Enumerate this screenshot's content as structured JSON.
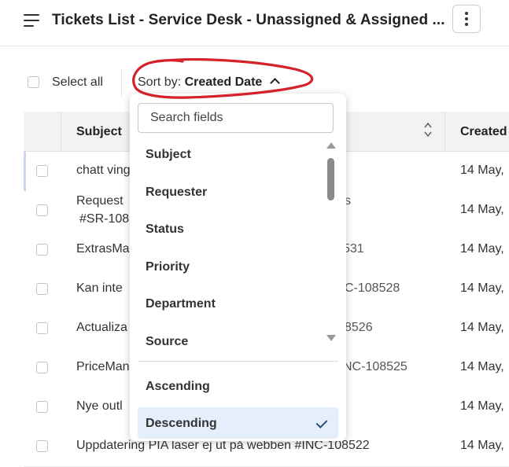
{
  "header": {
    "title": "Tickets List  -  Service Desk - Unassigned & Assigned ...",
    "menu_icon": "hamburger-icon",
    "more_icon": "kebab-menu-icon"
  },
  "toolbar": {
    "select_all_label": "Select all",
    "sort_prefix": "Sort by:",
    "sort_value": "Created Date"
  },
  "table": {
    "columns": [
      "Subject",
      "Created"
    ],
    "rows": [
      {
        "subject": "chatt ving",
        "subject_line2": "",
        "mid": "",
        "created": "14 May,"
      },
      {
        "subject": "Request",
        "subject_line2": "#SR-108",
        "mid": "s",
        "created": "14 May,"
      },
      {
        "subject": "ExtrasMa",
        "subject_line2": "",
        "mid": "531",
        "created": "14 May,"
      },
      {
        "subject": "Kan inte",
        "subject_line2": "",
        "mid": "C-108528",
        "created": "14 May,"
      },
      {
        "subject": "Actualiza",
        "subject_line2": "",
        "mid": "8526",
        "created": "14 May,"
      },
      {
        "subject": "PriceMan",
        "subject_line2": "",
        "mid": "NC-108525",
        "created": "14 May,"
      },
      {
        "subject": "Nye outl",
        "subject_line2": "",
        "mid": "",
        "created": "14 May,"
      },
      {
        "subject": "Uppdatering PIA laser ej ut på webben  #INC-108522",
        "subject_line2": "",
        "mid": "",
        "created": "14 May,"
      }
    ]
  },
  "dropdown": {
    "search_placeholder": "Search fields",
    "fields": [
      "Subject",
      "Requester",
      "Status",
      "Priority",
      "Department",
      "Source"
    ],
    "orders": [
      "Ascending",
      "Descending"
    ],
    "selected_order": "Descending"
  },
  "colors": {
    "annotation": "#d4212a",
    "selected_bg": "#e5eefb",
    "header_bg": "#f1f2f4",
    "check": "#2c4f7c"
  }
}
